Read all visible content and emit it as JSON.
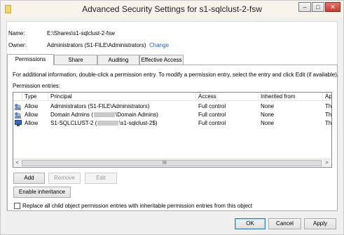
{
  "window": {
    "title": "Advanced Security Settings for s1-sqlclust-2-fsw",
    "controls": {
      "minimize": "–",
      "maximize": "□",
      "close": "✕"
    }
  },
  "info": {
    "name_label": "Name:",
    "name_value": "E:\\Shares\\s1-sqlclust-2-fsw",
    "owner_label": "Owner:",
    "owner_value": "Administrators (S1-FILE\\Administrators)",
    "change_link": "Change"
  },
  "tabs": [
    {
      "label": "Permissions",
      "active": true
    },
    {
      "label": "Share",
      "active": false
    },
    {
      "label": "Auditing",
      "active": false
    },
    {
      "label": "Effective Access",
      "active": false
    }
  ],
  "description": "For additional information, double-click a permission entry. To modify a permission entry, select the entry and click Edit (if available).",
  "entries_label": "Permission entries:",
  "grid": {
    "columns": [
      "Type",
      "Principal",
      "Access",
      "Inherited from",
      "Applie"
    ],
    "rows": [
      {
        "icon": "users-icon",
        "type": "Allow",
        "principal_a": "Administrators (S1-FILE\\Administrators)",
        "principal_b": "",
        "access": "Full control",
        "inherited": "None",
        "applies": "This fo"
      },
      {
        "icon": "users-icon",
        "type": "Allow",
        "principal_a": "Domain Admins (",
        "principal_b": "\\Domain Admins)",
        "access": "Full control",
        "inherited": "None",
        "applies": "This fo"
      },
      {
        "icon": "computer-icon",
        "type": "Allow",
        "principal_a": "S1-SQLCLUST-2 (",
        "principal_b": "\\s1-sqlclust-2$)",
        "access": "Full control",
        "inherited": "None",
        "applies": "This fo"
      }
    ],
    "scroll": {
      "left": "<",
      "right": ">",
      "grip": "III"
    }
  },
  "buttons": {
    "add": "Add",
    "remove": "Remove",
    "edit": "Edit",
    "enable_inheritance": "Enable inheritance",
    "ok": "OK",
    "cancel": "Cancel",
    "apply": "Apply"
  },
  "replace_checkbox": {
    "label": "Replace all child object permission entries with inheritable permission entries from this object",
    "checked": false
  }
}
